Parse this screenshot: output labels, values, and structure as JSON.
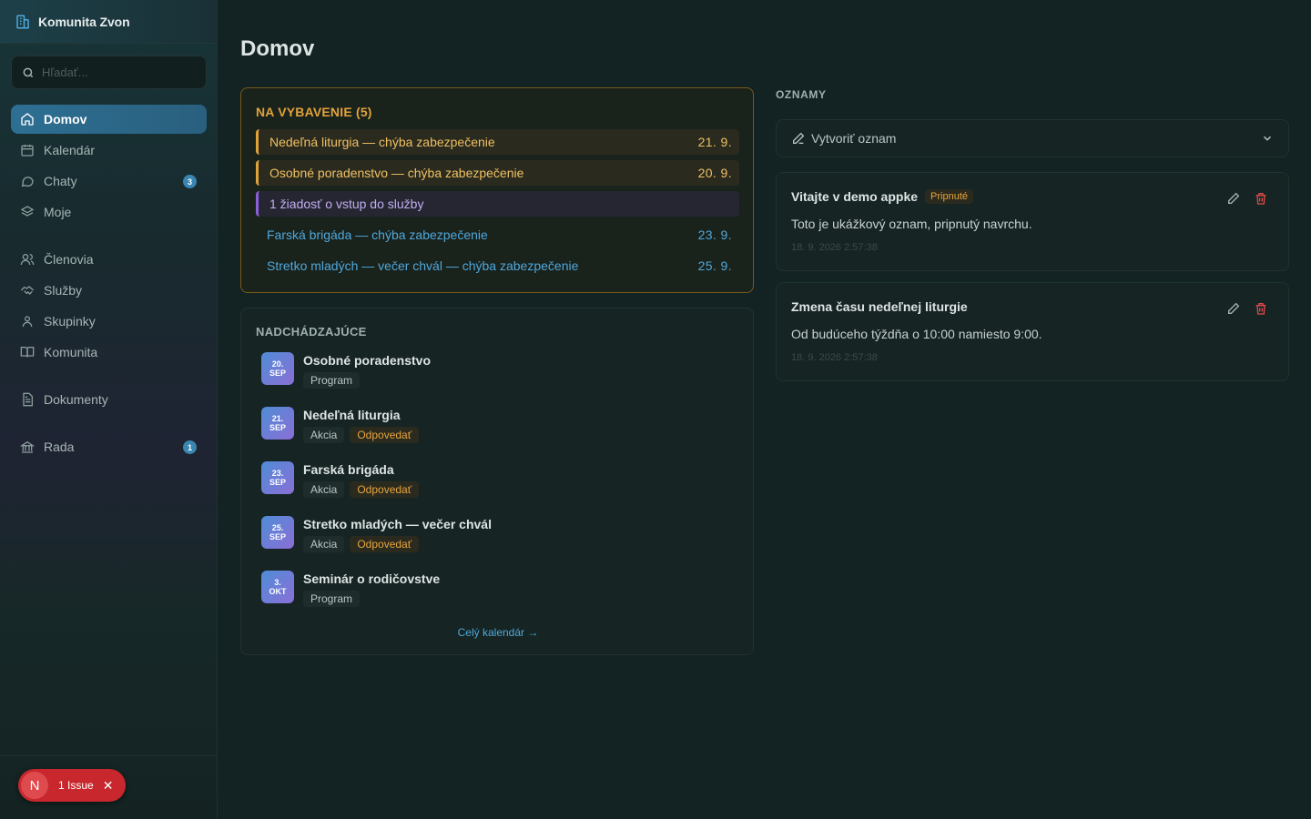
{
  "app": {
    "name": "Komunita Zvon"
  },
  "search": {
    "placeholder": "Hľadať..."
  },
  "nav": [
    {
      "label": "Domov",
      "icon": "home-icon",
      "active": true
    },
    {
      "label": "Kalendár",
      "icon": "calendar-icon"
    },
    {
      "label": "Chaty",
      "icon": "chat-icon",
      "badge": "3"
    },
    {
      "label": "Moje",
      "icon": "layers-icon"
    },
    {
      "label": "Členovia",
      "icon": "users-icon"
    },
    {
      "label": "Služby",
      "icon": "handshake-icon"
    },
    {
      "label": "Skupinky",
      "icon": "group-icon"
    },
    {
      "label": "Komunita",
      "icon": "book-icon"
    },
    {
      "label": "Dokumenty",
      "icon": "document-icon"
    },
    {
      "label": "Rada",
      "icon": "landmark-icon",
      "badge": "1"
    }
  ],
  "issue": {
    "letter": "N",
    "label": "1 Issue"
  },
  "page": {
    "title": "Domov"
  },
  "attention": {
    "title": "NA VYBAVENIE (5)",
    "items": [
      {
        "text": "Nedeľná liturgia — chýba zabezpečenie",
        "date": "21. 9.",
        "kind": "warn"
      },
      {
        "text": "Osobné poradenstvo — chýba zabezpečenie",
        "date": "20. 9.",
        "kind": "warn"
      },
      {
        "text": "1 žiadosť o vstup do služby",
        "date": "",
        "kind": "purple"
      },
      {
        "text": "Farská brigáda — chýba zabezpečenie",
        "date": "23. 9.",
        "kind": "info"
      },
      {
        "text": "Stretko mladých — večer chvál — chýba zabezpečenie",
        "date": "25. 9.",
        "kind": "info"
      }
    ]
  },
  "upcoming": {
    "title": "NADCHÁDZAJÚCE",
    "events": [
      {
        "day": "20.",
        "month": "SEP",
        "name": "Osobné poradenstvo",
        "type": "Program",
        "action": ""
      },
      {
        "day": "21.",
        "month": "SEP",
        "name": "Nedeľná liturgia",
        "type": "Akcia",
        "action": "Odpovedať"
      },
      {
        "day": "23.",
        "month": "SEP",
        "name": "Farská brigáda",
        "type": "Akcia",
        "action": "Odpovedať"
      },
      {
        "day": "25.",
        "month": "SEP",
        "name": "Stretko mladých — večer chvál",
        "type": "Akcia",
        "action": "Odpovedať"
      },
      {
        "day": "3.",
        "month": "OKT",
        "name": "Seminár o rodičovstve",
        "type": "Program",
        "action": ""
      }
    ],
    "link": "Celý kalendár →"
  },
  "announcements": {
    "title": "OZNAMY",
    "create_label": "Vytvoriť oznam",
    "items": [
      {
        "title": "Vitajte v demo appke",
        "pinned": "Pripnuté",
        "body": "Toto je ukážkový oznam, pripnutý navrchu.",
        "timestamp": "18. 9. 2026 2:57:38"
      },
      {
        "title": "Zmena času nedeľnej liturgie",
        "pinned": "",
        "body": "Od budúceho týždňa o 10:00 namiesto 9:00.",
        "timestamp": "18. 9. 2026 2:57:38"
      }
    ]
  },
  "colors": {
    "accent": "#2d6f93",
    "warning": "#e0a33b",
    "info": "#4fa8dc",
    "danger": "#e04a4a",
    "purple": "#8a5fd8"
  }
}
